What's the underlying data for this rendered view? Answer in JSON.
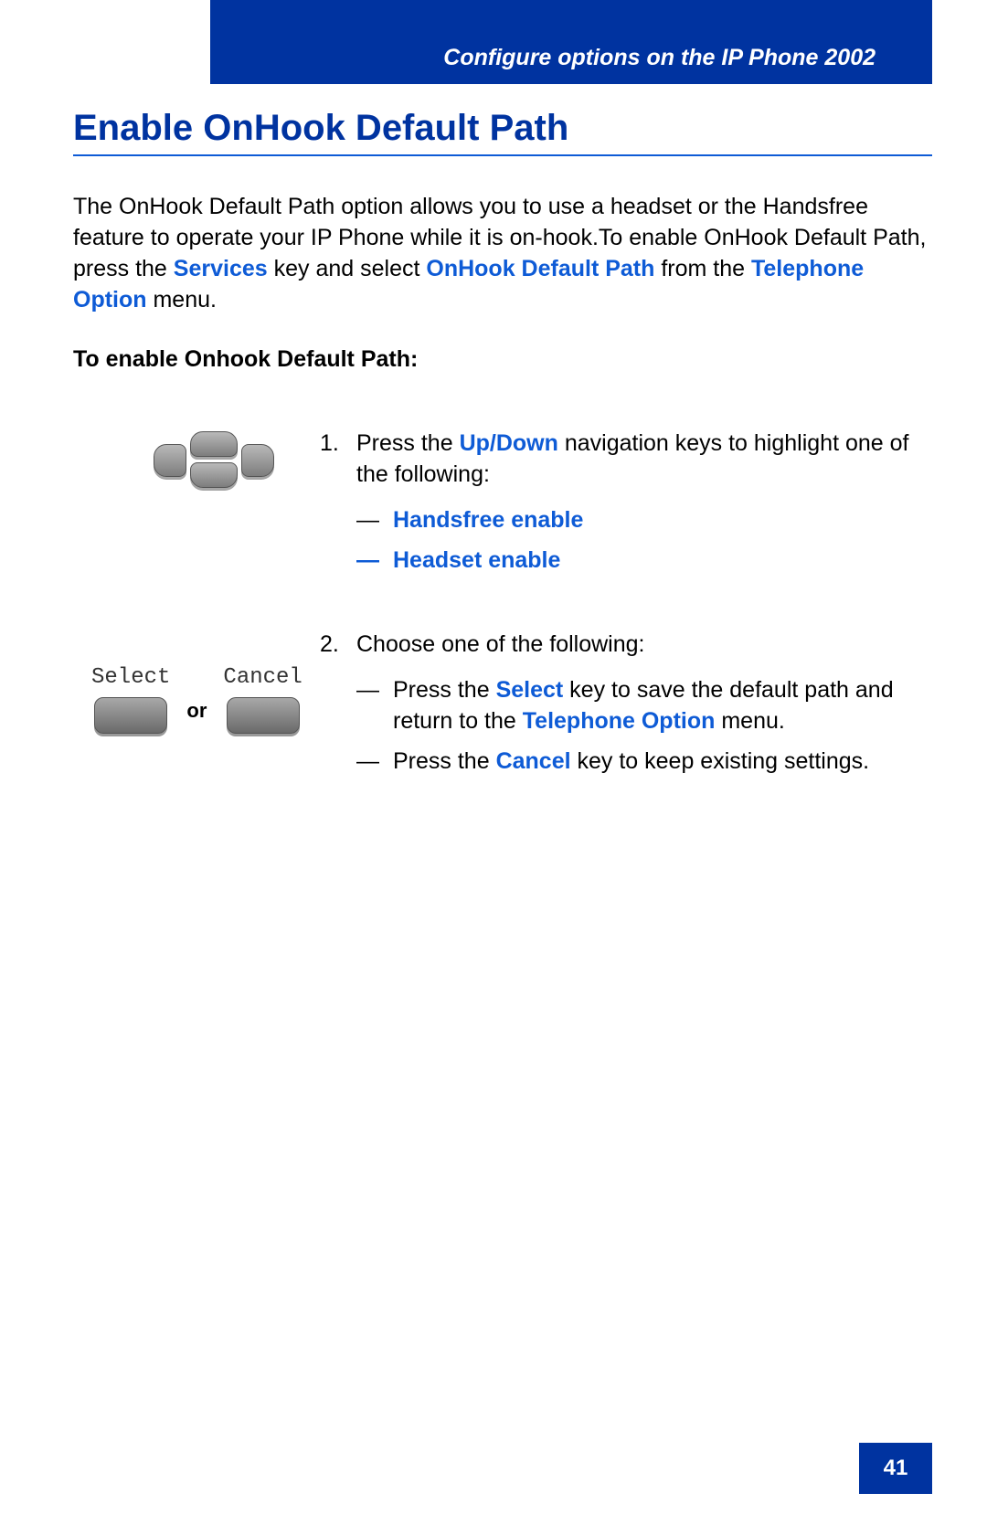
{
  "header": {
    "title": "Configure options on the IP Phone 2002"
  },
  "page_number": "41",
  "title": "Enable OnHook Default Path",
  "intro": {
    "t1": "The OnHook Default Path option allows you to use a headset or the Handsfree feature to operate your IP Phone while it is on-hook.To enable OnHook Default Path, press the ",
    "k1": "Services",
    "t2": " key and select ",
    "k2": "OnHook Default Path",
    "t3": " from the ",
    "k3": "Telephone Option",
    "t4": " menu."
  },
  "subhead": "To enable Onhook Default Path:",
  "step1": {
    "num": "1.",
    "t1": "Press the ",
    "k1": "Up/Down",
    "t2": " navigation keys to highlight one of the following:",
    "dash": "—",
    "opt1": "Handsfree enable",
    "opt2": "Headset enable"
  },
  "step2": {
    "num": "2.",
    "t1": "Choose one of the following:",
    "dash": "—",
    "a_t1": "Press the ",
    "a_k1": "Select",
    "a_t2": " key to save the default path and return to the ",
    "a_k2": "Telephone Option",
    "a_t3": " menu.",
    "b_t1": "Press the ",
    "b_k1": "Cancel",
    "b_t2": " key to keep existing settings."
  },
  "buttons": {
    "select": "Select",
    "cancel": "Cancel",
    "or": "or"
  }
}
